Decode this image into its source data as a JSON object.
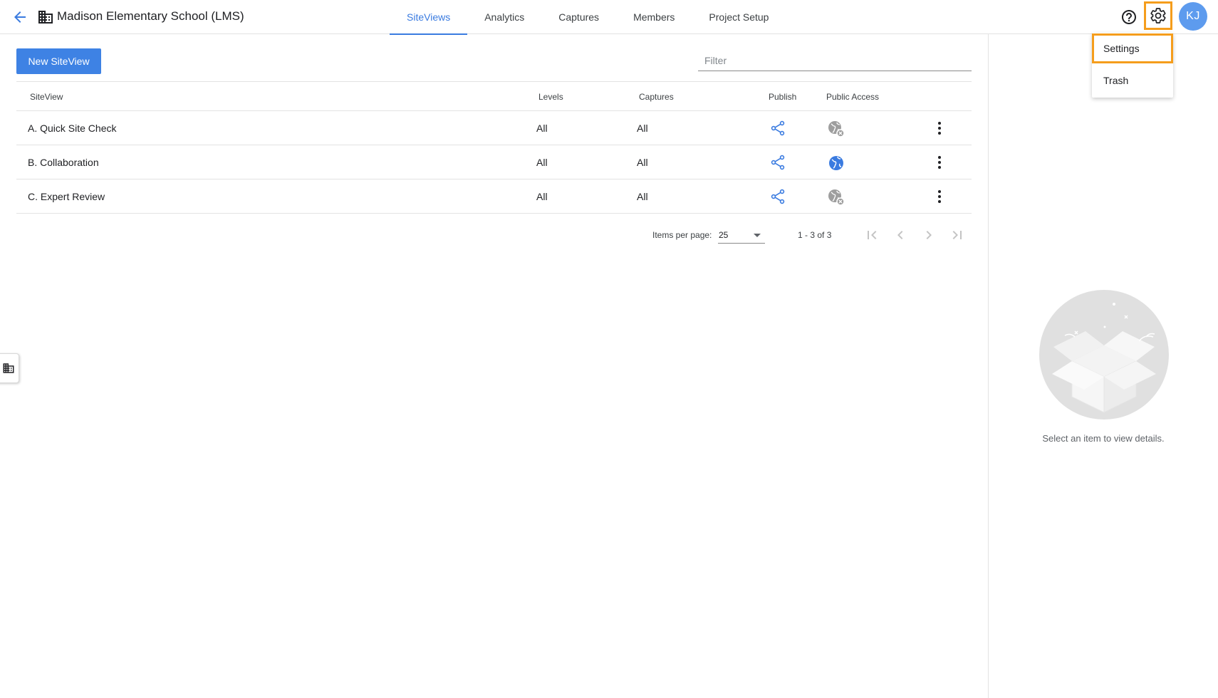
{
  "header": {
    "project_title": "Madison Elementary School (LMS)",
    "tabs": [
      {
        "label": "SiteViews",
        "active": true
      },
      {
        "label": "Analytics",
        "active": false
      },
      {
        "label": "Captures",
        "active": false
      },
      {
        "label": "Members",
        "active": false
      },
      {
        "label": "Project Setup",
        "active": false
      }
    ],
    "avatar_initials": "KJ",
    "accent_color": "#3a7be0",
    "highlight_color": "#f59d1c"
  },
  "menu": {
    "items": [
      {
        "label": "Settings"
      },
      {
        "label": "Trash"
      }
    ]
  },
  "toolbar": {
    "new_button": "New SiteView",
    "filter_placeholder": "Filter"
  },
  "table": {
    "columns": [
      "SiteView",
      "Levels",
      "Captures",
      "Publish",
      "Public Access"
    ],
    "rows": [
      {
        "name": "A. Quick Site Check",
        "levels": "All",
        "captures": "All",
        "public": false
      },
      {
        "name": "B. Collaboration",
        "levels": "All",
        "captures": "All",
        "public": true
      },
      {
        "name": "C. Expert Review",
        "levels": "All",
        "captures": "All",
        "public": false
      }
    ]
  },
  "pagination": {
    "items_per_page_label": "Items per page:",
    "items_per_page": "25",
    "range": "1 - 3 of 3"
  },
  "detail_panel": {
    "empty_text": "Select an item to view details."
  },
  "icons": {
    "back": "arrow-left-icon",
    "building": "building-icon",
    "help": "help-circle-icon",
    "settings": "gear-icon",
    "publish": "share-icon",
    "public_on": "globe-icon",
    "public_off": "globe-off-icon",
    "more": "more-vertical-icon"
  }
}
